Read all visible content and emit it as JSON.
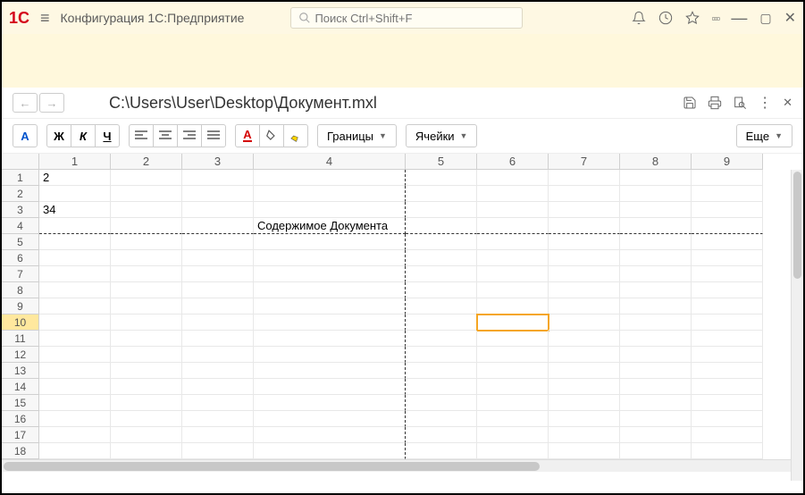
{
  "app": {
    "title": "Конфигурация 1С:Предприятие",
    "search_placeholder": "Поиск Ctrl+Shift+F"
  },
  "doc": {
    "path": "C:\\Users\\User\\Desktop\\Документ.mxl"
  },
  "toolbar": {
    "font_color": "А",
    "bold": "Ж",
    "italic": "К",
    "underline": "Ч",
    "text_color": "А",
    "borders": "Границы",
    "cells": "Ячейки",
    "more": "Еще"
  },
  "sheet": {
    "cols": [
      "1",
      "2",
      "3",
      "4",
      "5",
      "6",
      "7",
      "8",
      "9"
    ],
    "rows": [
      "1",
      "2",
      "3",
      "4",
      "5",
      "6",
      "7",
      "8",
      "9",
      "10",
      "11",
      "12",
      "13",
      "14",
      "15",
      "16",
      "17",
      "18"
    ],
    "selected_row": "10",
    "selected_cell": {
      "r": 10,
      "c": 6
    },
    "cells": {
      "r1c1": "2",
      "r3c1": "34",
      "r4c4": "Содержимое Документа"
    }
  }
}
